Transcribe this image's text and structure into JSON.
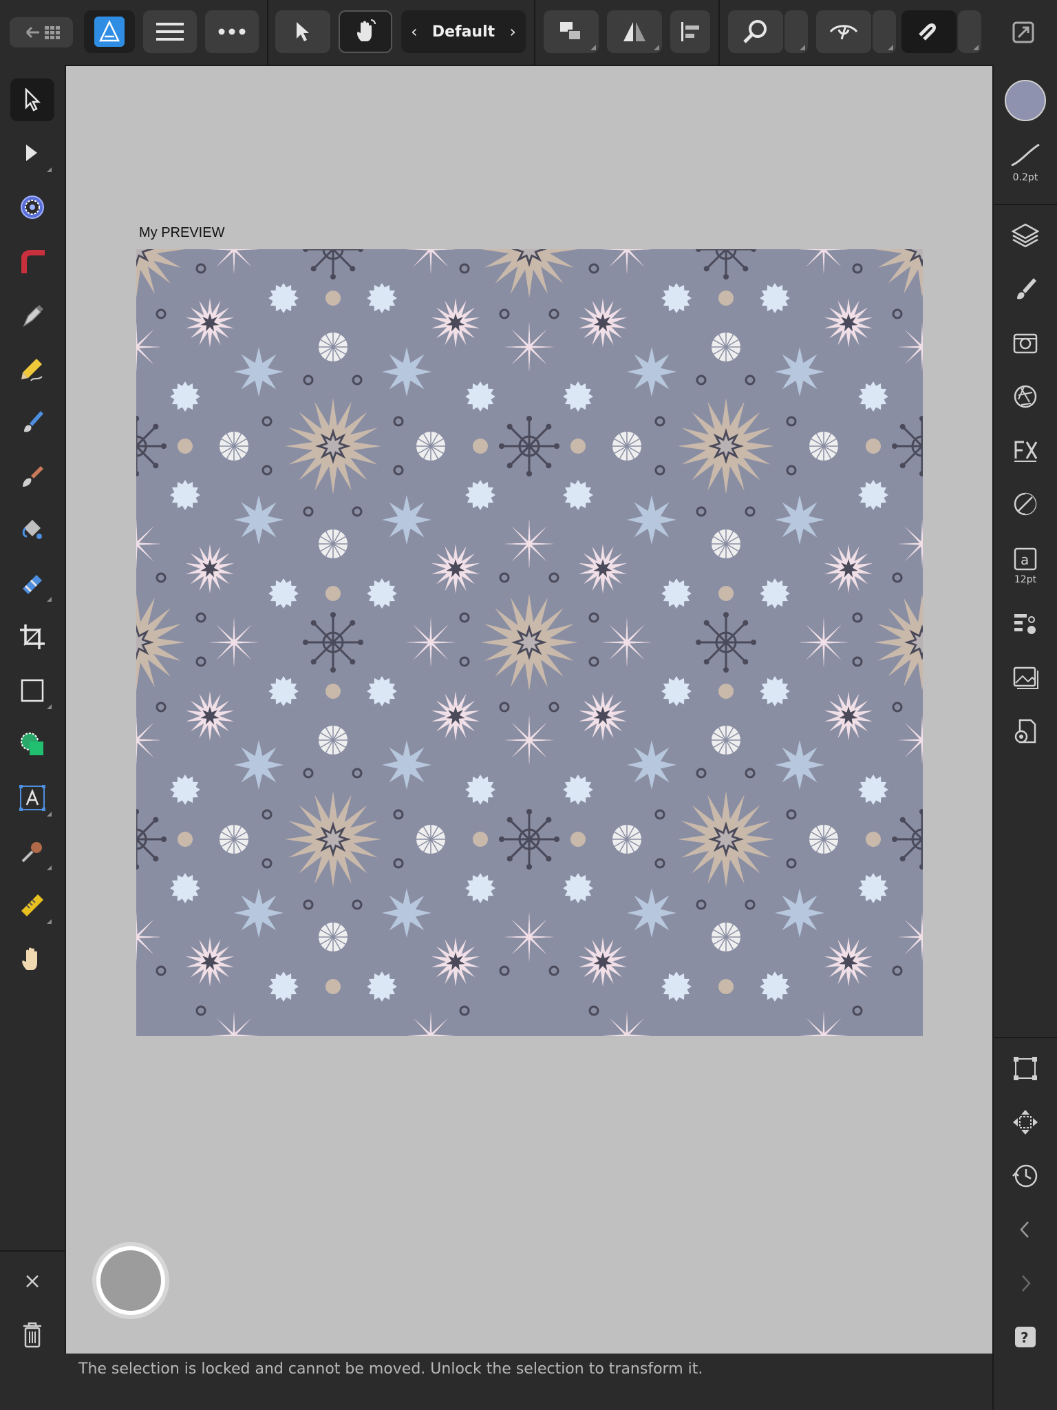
{
  "toolbar": {
    "preset_label": "Default",
    "back_icon": "back-grid-icon",
    "app_icon": "affinity-designer-icon"
  },
  "document": {
    "title": "My PREVIEW",
    "pattern_colors": {
      "background": "#8a8ea3",
      "tan": "#c9b9ab",
      "dark": "#4a4a5a",
      "pink": "#f0dfe6",
      "light_blue": "#dbe7f5",
      "steel_blue": "#b7c7dd",
      "white": "#eeeeee"
    }
  },
  "stroke": {
    "width_label": "0.2pt",
    "fill_color": "#8f92ae"
  },
  "text_tool": {
    "size_label": "12pt"
  },
  "status": {
    "message": "The selection is locked and cannot be moved. Unlock the selection to transform it."
  }
}
